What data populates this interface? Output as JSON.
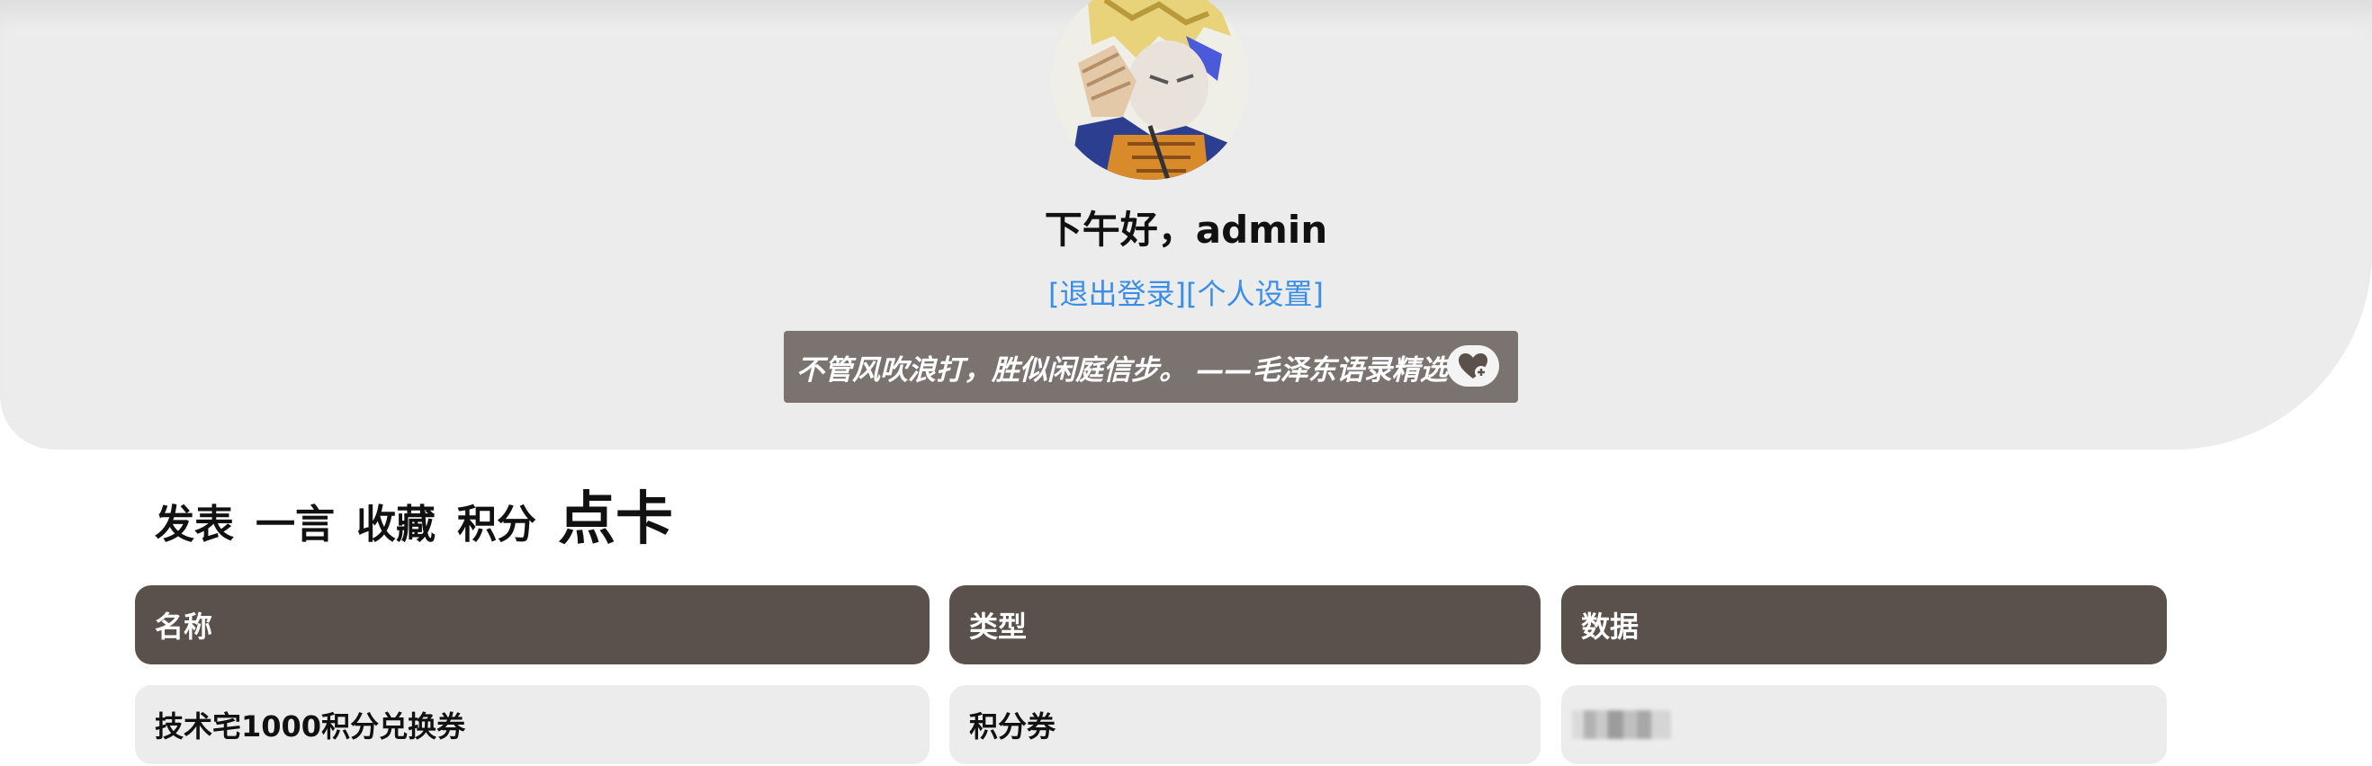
{
  "profile": {
    "greeting": "下午好，admin",
    "logout_link": "[退出登录]",
    "settings_link": "[个人设置]"
  },
  "quote": {
    "text": "不管风吹浪打，胜似闲庭信步。 ——毛泽东语录精选"
  },
  "tabs": [
    {
      "label": "发表",
      "active": false
    },
    {
      "label": "一言",
      "active": false
    },
    {
      "label": "收藏",
      "active": false
    },
    {
      "label": "积分",
      "active": false
    },
    {
      "label": "点卡",
      "active": true
    }
  ],
  "table": {
    "headers": [
      "名称",
      "类型",
      "数据"
    ],
    "rows": [
      [
        "技术宅1000积分兑换券",
        "积分券",
        ""
      ]
    ]
  },
  "colors": {
    "hero_bg": "#ececec",
    "link": "#3a8ee6",
    "quote_bg": "#7a7370",
    "table_header": "#5a504c",
    "table_row": "#ececec"
  },
  "icons": {
    "avatar": "anime-avatar",
    "like": "heart-plus-icon"
  }
}
